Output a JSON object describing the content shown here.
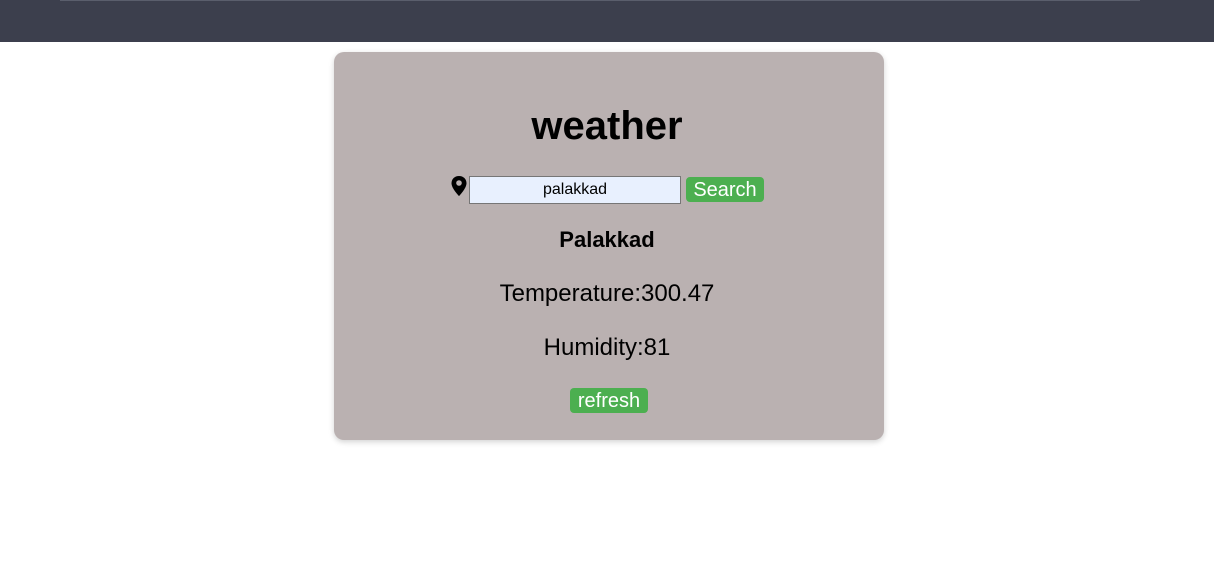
{
  "app": {
    "title": "weather"
  },
  "search": {
    "input_value": "palakkad",
    "button_label": "Search"
  },
  "result": {
    "city": "Palakkad",
    "temperature_text": "Temperature:300.47",
    "humidity_text": "Humidity:81"
  },
  "actions": {
    "refresh_label": "refresh"
  },
  "icons": {
    "location": "map-pin-icon"
  },
  "colors": {
    "topbar": "#3c3f4d",
    "card": "#bab1b1",
    "button": "#4caf50",
    "input_bg": "#e8f0fe"
  }
}
